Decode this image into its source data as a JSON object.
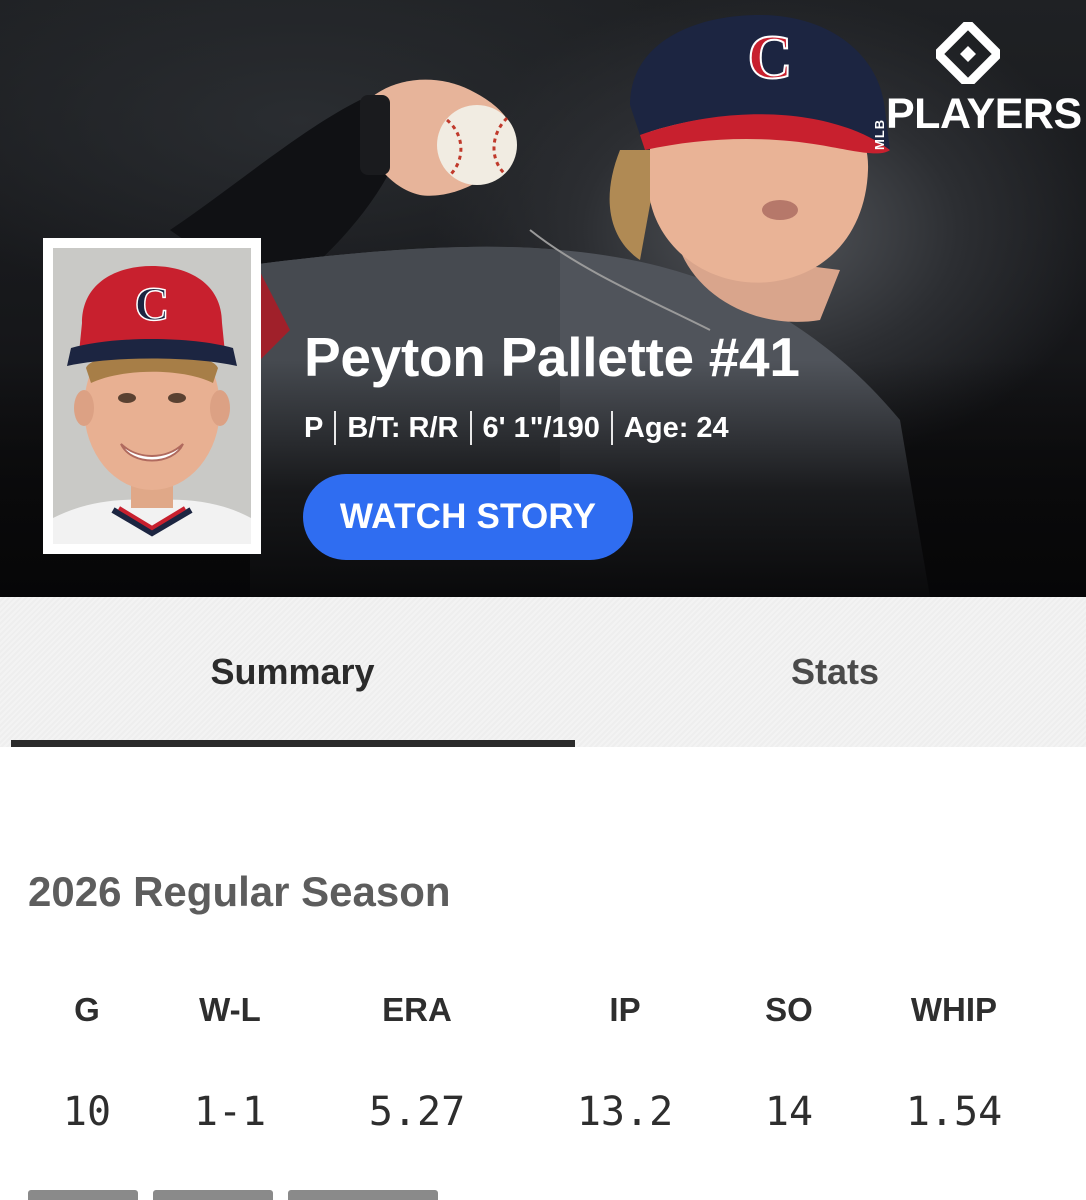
{
  "brand": {
    "wordmark": "PLAYERS",
    "prefix": "MLB"
  },
  "player": {
    "name": "Peyton Pallette #41",
    "position": "P",
    "bats_throws": "B/T: R/R",
    "height_weight": "6' 1\"/190",
    "age": "Age: 24",
    "cap_letter": "C"
  },
  "hero": {
    "cta_label": "WATCH STORY"
  },
  "tabs": [
    {
      "label": "Summary",
      "active": true
    },
    {
      "label": "Stats",
      "active": false
    }
  ],
  "season": {
    "title": "2026 Regular Season",
    "headers": [
      "G",
      "W-L",
      "ERA",
      "IP",
      "SO",
      "WHIP"
    ],
    "values": [
      "10",
      "1-1",
      "5.27",
      "13.2",
      "14",
      "1.54"
    ]
  },
  "colors": {
    "accent_button": "#2f6df1",
    "cap_red": "#c8202e",
    "cap_navy": "#1c2541"
  },
  "icons": [
    "mlb-players-logo-icon"
  ]
}
